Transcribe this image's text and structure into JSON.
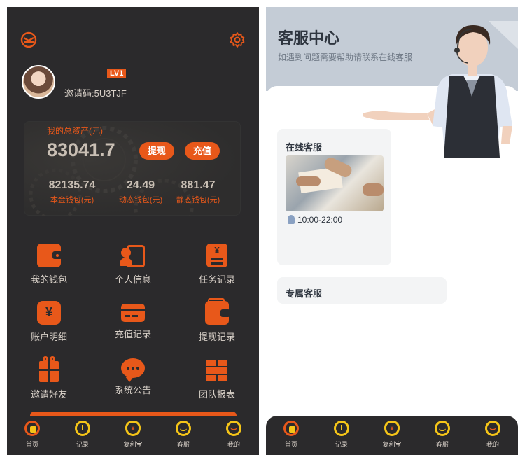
{
  "colors": {
    "accent": "#e8581a",
    "tab_icon": "#f5c518",
    "dark_bg": "#2b2a2c"
  },
  "left": {
    "user": {
      "level": "LV1",
      "invite_code": "邀请码:5U3TJF"
    },
    "assets": {
      "label": "我的总资产(元)",
      "total": "83041.7",
      "withdraw_label": "提现",
      "recharge_label": "充值",
      "wallets": [
        {
          "value": "82135.74",
          "label": "本金钱包(元)"
        },
        {
          "value": "24.49",
          "label": "动态钱包(元)"
        },
        {
          "value": "881.47",
          "label": "静态钱包(元)"
        }
      ]
    },
    "menu": [
      {
        "label": "我的钱包",
        "icon": "wallet-icon"
      },
      {
        "label": "个人信息",
        "icon": "profile-card-icon"
      },
      {
        "label": "任务记录",
        "icon": "document-yen-icon"
      },
      {
        "label": "账户明细",
        "icon": "yen-icon"
      },
      {
        "label": "充值记录",
        "icon": "card-icon"
      },
      {
        "label": "提现记录",
        "icon": "withdraw-wallet-icon"
      },
      {
        "label": "邀请好友",
        "icon": "gift-icon"
      },
      {
        "label": "系统公告",
        "icon": "chat-bubble-icon"
      },
      {
        "label": "团队报表",
        "icon": "grid-report-icon"
      }
    ]
  },
  "tabs": [
    {
      "label": "首页",
      "icon": "home-icon"
    },
    {
      "label": "记录",
      "icon": "clock-icon"
    },
    {
      "label": "复利宝",
      "icon": "money-bag-icon"
    },
    {
      "label": "客服",
      "icon": "chat-icon"
    },
    {
      "label": "我的",
      "icon": "user-icon"
    }
  ],
  "right": {
    "title": "客服中心",
    "subtitle": "如遇到问题需要帮助请联系在线客服",
    "online": {
      "title": "在线客服",
      "hours": "10:00-22:00"
    },
    "exclusive": {
      "title": "专属客服"
    }
  }
}
